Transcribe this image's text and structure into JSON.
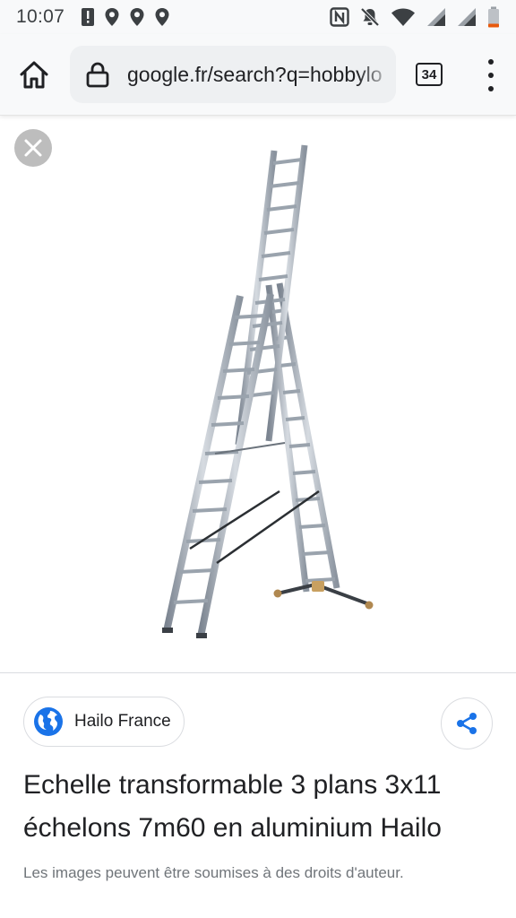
{
  "status_bar": {
    "time": "10:07",
    "icons": [
      "alert-icon",
      "location-icon",
      "location-icon",
      "location-icon",
      "nfc-icon",
      "mute-icon",
      "wifi-icon",
      "signal-icon",
      "signal-icon",
      "battery-icon"
    ]
  },
  "browser": {
    "url": "google.fr/search?q=hobbylo",
    "tab_count": "34",
    "accent": "#1a73e8"
  },
  "result": {
    "source": "Hailo France",
    "title": "Echelle transformable 3 plans 3x11 échelons 7m60 en aluminium Hailo",
    "copyright_notice": "Les images peuvent être soumises à des droits d'auteur."
  }
}
